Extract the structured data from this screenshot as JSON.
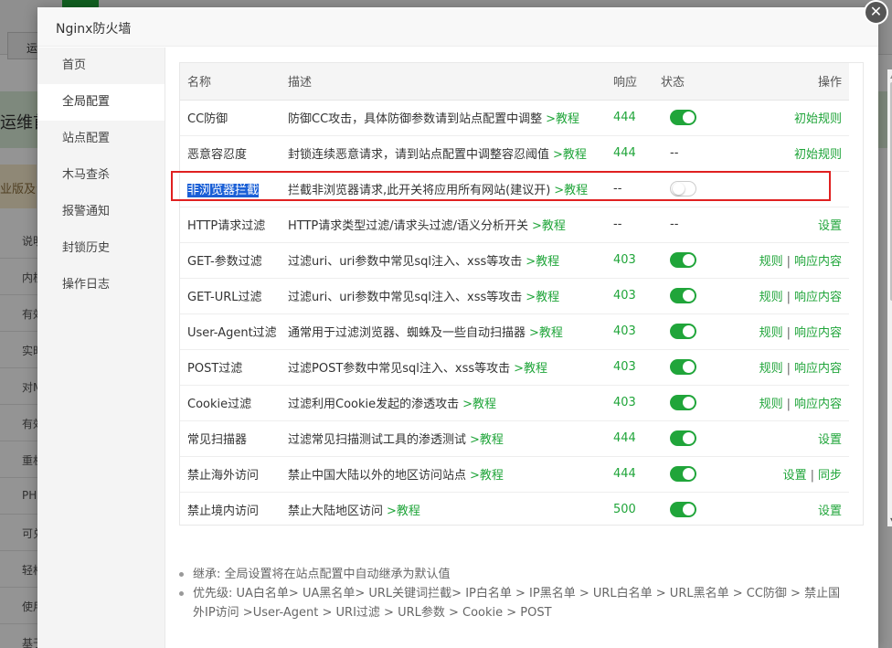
{
  "background": {
    "tab_label": "运",
    "banner_text": "运维首",
    "yellow_tag": "业版及企",
    "rows": [
      "说明",
      "内核",
      "有效",
      "实时",
      "对M",
      "有效",
      "重机",
      "PH",
      "可兑",
      "轻松",
      "使用"
    ],
    "bottom_text": "基于"
  },
  "modal": {
    "title": "Nginx防火墙",
    "close_icon": "close-icon",
    "sidebar": [
      {
        "label": "首页",
        "active": false
      },
      {
        "label": "全局配置",
        "active": true
      },
      {
        "label": "站点配置",
        "active": false
      },
      {
        "label": "木马查杀",
        "active": false
      },
      {
        "label": "报警通知",
        "active": false
      },
      {
        "label": "封锁历史",
        "active": false
      },
      {
        "label": "操作日志",
        "active": false
      }
    ],
    "table": {
      "headers": {
        "name": "名称",
        "desc": "描述",
        "resp": "响应",
        "status": "状态",
        "ops": "操作"
      },
      "rows": [
        {
          "name": "CC防御",
          "desc": "防御CC攻击，具体防御参数请到站点配置中调整",
          "tutorial": ">教程",
          "resp": "444",
          "status": "on",
          "ops": [
            "初始规则"
          ]
        },
        {
          "name": "恶意容忍度",
          "desc": "封锁连续恶意请求，请到站点配置中调整容忍阈值",
          "tutorial": ">教程",
          "resp": "444",
          "status": "--",
          "ops": [
            "初始规则"
          ]
        },
        {
          "name": "非浏览器拦截",
          "desc": "拦截非浏览器请求,此开关将应用所有网站(建议开)",
          "tutorial": ">教程",
          "resp": "--",
          "status": "off",
          "ops": [],
          "selected": true
        },
        {
          "name": "HTTP请求过滤",
          "desc": "HTTP请求类型过滤/请求头过滤/语义分析开关",
          "tutorial": ">教程",
          "resp": "--",
          "status": "--",
          "ops": [
            "设置"
          ]
        },
        {
          "name": "GET-参数过滤",
          "desc": "过滤uri、uri参数中常见sql注入、xss等攻击",
          "tutorial": ">教程",
          "resp": "403",
          "status": "on",
          "ops": [
            "规则",
            "响应内容"
          ]
        },
        {
          "name": "GET-URL过滤",
          "desc": "过滤uri、uri参数中常见sql注入、xss等攻击",
          "tutorial": ">教程",
          "resp": "403",
          "status": "on",
          "ops": [
            "规则",
            "响应内容"
          ]
        },
        {
          "name": "User-Agent过滤",
          "desc": "通常用于过滤浏览器、蜘蛛及一些自动扫描器",
          "tutorial": ">教程",
          "resp": "403",
          "status": "on",
          "ops": [
            "规则",
            "响应内容"
          ]
        },
        {
          "name": "POST过滤",
          "desc": "过滤POST参数中常见sql注入、xss等攻击",
          "tutorial": ">教程",
          "resp": "403",
          "status": "on",
          "ops": [
            "规则",
            "响应内容"
          ]
        },
        {
          "name": "Cookie过滤",
          "desc": "过滤利用Cookie发起的渗透攻击",
          "tutorial": ">教程",
          "resp": "403",
          "status": "on",
          "ops": [
            "规则",
            "响应内容"
          ]
        },
        {
          "name": "常见扫描器",
          "desc": "过滤常见扫描测试工具的渗透测试",
          "tutorial": ">教程",
          "resp": "444",
          "status": "on",
          "ops": [
            "设置"
          ]
        },
        {
          "name": "禁止海外访问",
          "desc": "禁止中国大陆以外的地区访问站点",
          "tutorial": ">教程",
          "resp": "444",
          "status": "on",
          "ops": [
            "设置",
            "同步"
          ]
        },
        {
          "name": "禁止境内访问",
          "desc": "禁止大陆地区访问",
          "tutorial": ">教程",
          "resp": "500",
          "status": "on",
          "ops": [
            "设置"
          ]
        }
      ]
    },
    "notes": [
      "继承: 全局设置将在站点配置中自动继承为默认值",
      "优先级: UA白名单> UA黑名单> URL关键词拦截> IP白名单 > IP黑名单 > URL白名单 > URL黑名单 > CC防御 > 禁止国外IP访问 >User-Agent > URI过滤 > URL参数 > Cookie > POST"
    ],
    "colors": {
      "accent": "#20a53a",
      "highlight_border": "#e02020",
      "selection": "#1a5fd6"
    }
  }
}
